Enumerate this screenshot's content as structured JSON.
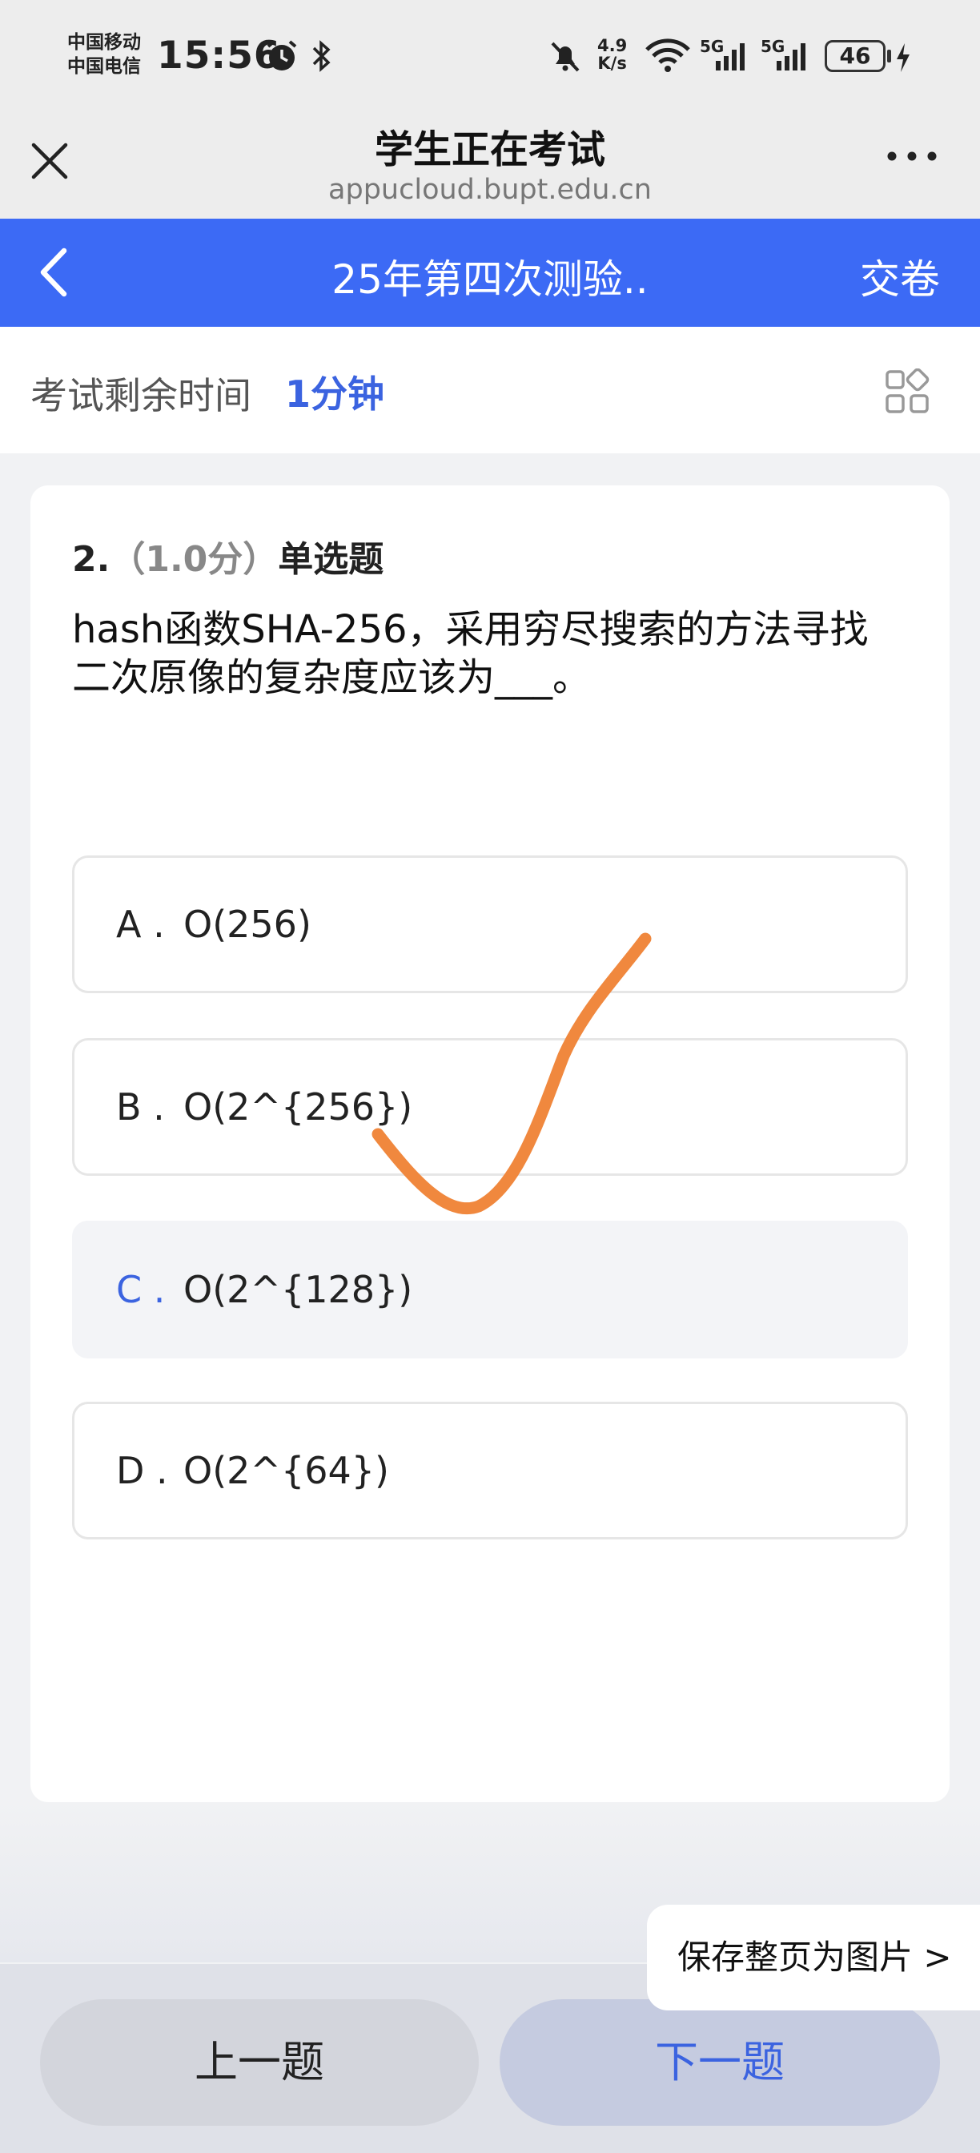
{
  "status_bar": {
    "carrier_1": "中国移动",
    "carrier_2": "中国电信",
    "time": "15:56",
    "net_speed_value": "4.9",
    "net_speed_unit": "K/s",
    "signal_1": "5G",
    "signal_2": "5G",
    "battery": "46"
  },
  "browser": {
    "title": "学生正在考试",
    "url": "appucloud.bupt.edu.cn"
  },
  "app_header": {
    "exam_name": "25年第四次测验..",
    "submit_label": "交卷"
  },
  "timer": {
    "label": "考试剩余时间",
    "value": "1分钟"
  },
  "question": {
    "number": "2.",
    "score": "（1.0分）",
    "type": "单选题",
    "text": "hash函数SHA-256，采用穷尽搜索的方法寻找二次原像的复杂度应该为___。",
    "options": [
      {
        "letter": "A .",
        "text": "O(256)"
      },
      {
        "letter": "B .",
        "text": "O(2^{256})"
      },
      {
        "letter": "C .",
        "text": "O(2^{128})"
      },
      {
        "letter": "D .",
        "text": "O(2^{64})"
      }
    ],
    "selected": "C"
  },
  "save_page_label": "保存整页为图片 >",
  "nav": {
    "prev_label": "上一题",
    "next_label": "下一题"
  },
  "colors": {
    "accent": "#3c6af5",
    "annotation": "#f0883e"
  }
}
